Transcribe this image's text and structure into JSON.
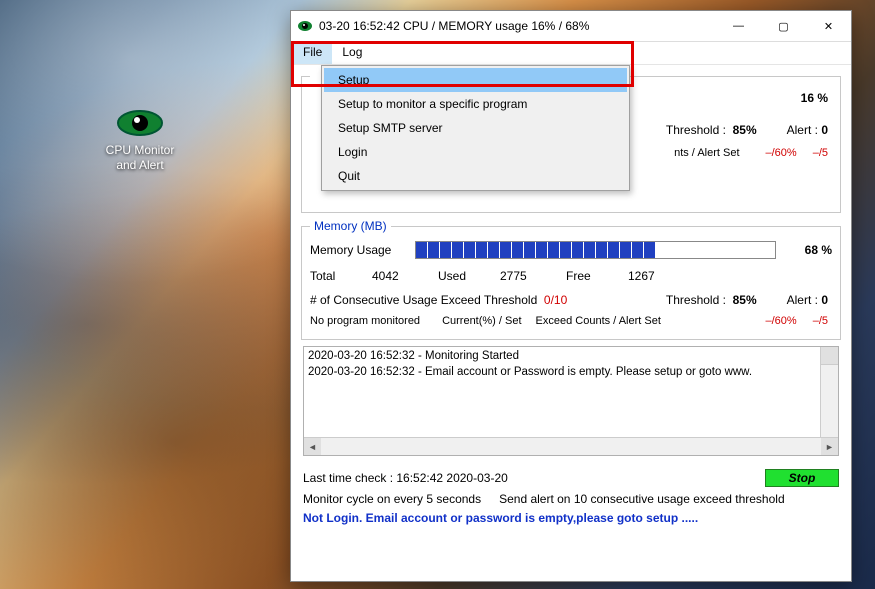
{
  "desktop": {
    "icon_label_1": "CPU Monitor",
    "icon_label_2": "and Alert"
  },
  "window": {
    "title": "03-20 16:52:42 CPU / MEMORY usage 16% / 68%"
  },
  "menubar": {
    "file": "File",
    "log": "Log"
  },
  "file_menu": {
    "setup": "Setup",
    "setup_program": "Setup to monitor a specific program",
    "setup_smtp": "Setup SMTP server",
    "login": "Login",
    "quit": "Quit"
  },
  "cpu": {
    "percent": "16 %",
    "threshold_label": "Threshold :",
    "threshold_value": "85%",
    "alert_label": "Alert :",
    "alert_value": "0",
    "counts_label": "nts / Alert Set",
    "pct_set": "–/60%",
    "alert_set": "–/5"
  },
  "mem": {
    "legend": "Memory (MB)",
    "usage_label": "Memory Usage",
    "percent": "68 %",
    "total_label": "Total",
    "total": "4042",
    "used_label": "Used",
    "used": "2775",
    "free_label": "Free",
    "free": "1267",
    "exceed_label": "# of Consecutive Usage Exceed Threshold",
    "exceed_value": "0/10",
    "threshold_label": "Threshold :",
    "threshold_value": "85%",
    "alert_label": "Alert :",
    "alert_value": "0",
    "noprog": "No program monitored",
    "current_label": "Current(%) / Set",
    "counts_label": "Exceed Counts / Alert Set",
    "pct_set": "–/60%",
    "alert_set": "–/5"
  },
  "log": {
    "line1": "2020-03-20 16:52:32 - Monitoring Started",
    "line2": "2020-03-20 16:52:32 - Email account or Password is empty. Please setup or goto www."
  },
  "bottom": {
    "last_check": "Last time check :  16:52:42 2020-03-20",
    "stop": "Stop",
    "cycle": "Monitor cycle on every 5 seconds",
    "spacer": "    ",
    "alert_rule": "Send alert on 10 consecutive usage exceed threshold",
    "status": "Not Login. Email account or password is empty,please goto setup ....."
  }
}
